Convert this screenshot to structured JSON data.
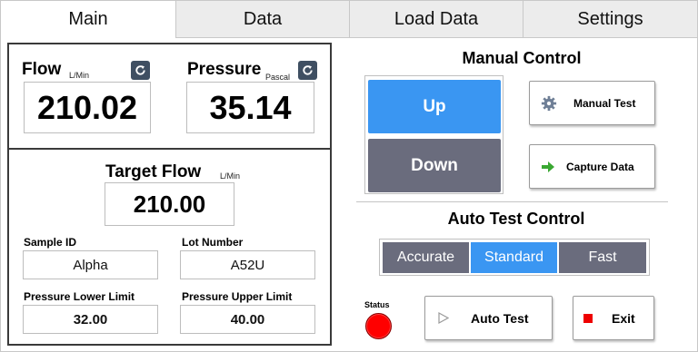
{
  "tabs": [
    {
      "label": "Main",
      "active": true
    },
    {
      "label": "Data",
      "active": false
    },
    {
      "label": "Load Data",
      "active": false
    },
    {
      "label": "Settings",
      "active": false
    }
  ],
  "flow": {
    "label": "Flow",
    "unit": "L/Min",
    "value": "210.02"
  },
  "pressure": {
    "label": "Pressure",
    "unit": "Pascal",
    "value": "35.14"
  },
  "target_flow": {
    "label": "Target Flow",
    "unit": "L/Min",
    "value": "210.00"
  },
  "sample_id": {
    "label": "Sample ID",
    "value": "Alpha"
  },
  "lot_number": {
    "label": "Lot Number",
    "value": "A52U"
  },
  "pressure_lower": {
    "label": "Pressure Lower Limit",
    "value": "32.00"
  },
  "pressure_upper": {
    "label": "Pressure Upper Limit",
    "value": "40.00"
  },
  "manual_control": {
    "title": "Manual Control",
    "up_label": "Up",
    "down_label": "Down",
    "manual_test_label": "Manual Test",
    "capture_data_label": "Capture Data"
  },
  "auto_test_control": {
    "title": "Auto Test Control",
    "modes": [
      {
        "label": "Accurate",
        "selected": false
      },
      {
        "label": "Standard",
        "selected": true
      },
      {
        "label": "Fast",
        "selected": false
      }
    ]
  },
  "status": {
    "label": "Status",
    "color": "#ff0000"
  },
  "auto_test_label": "Auto Test",
  "exit_label": "Exit",
  "colors": {
    "accent_blue": "#3a96f2",
    "button_gray": "#6a6c7d",
    "refresh_icon_bg": "#3f4f62",
    "status_red": "#ff0000",
    "exit_icon_red": "#ee0000",
    "capture_arrow_green": "#3aa832"
  },
  "icons": {
    "refresh": "refresh-icon",
    "manual_test": "gear-icon",
    "capture_data": "arrow-right-icon",
    "auto_test": "play-icon",
    "exit": "stop-icon"
  }
}
